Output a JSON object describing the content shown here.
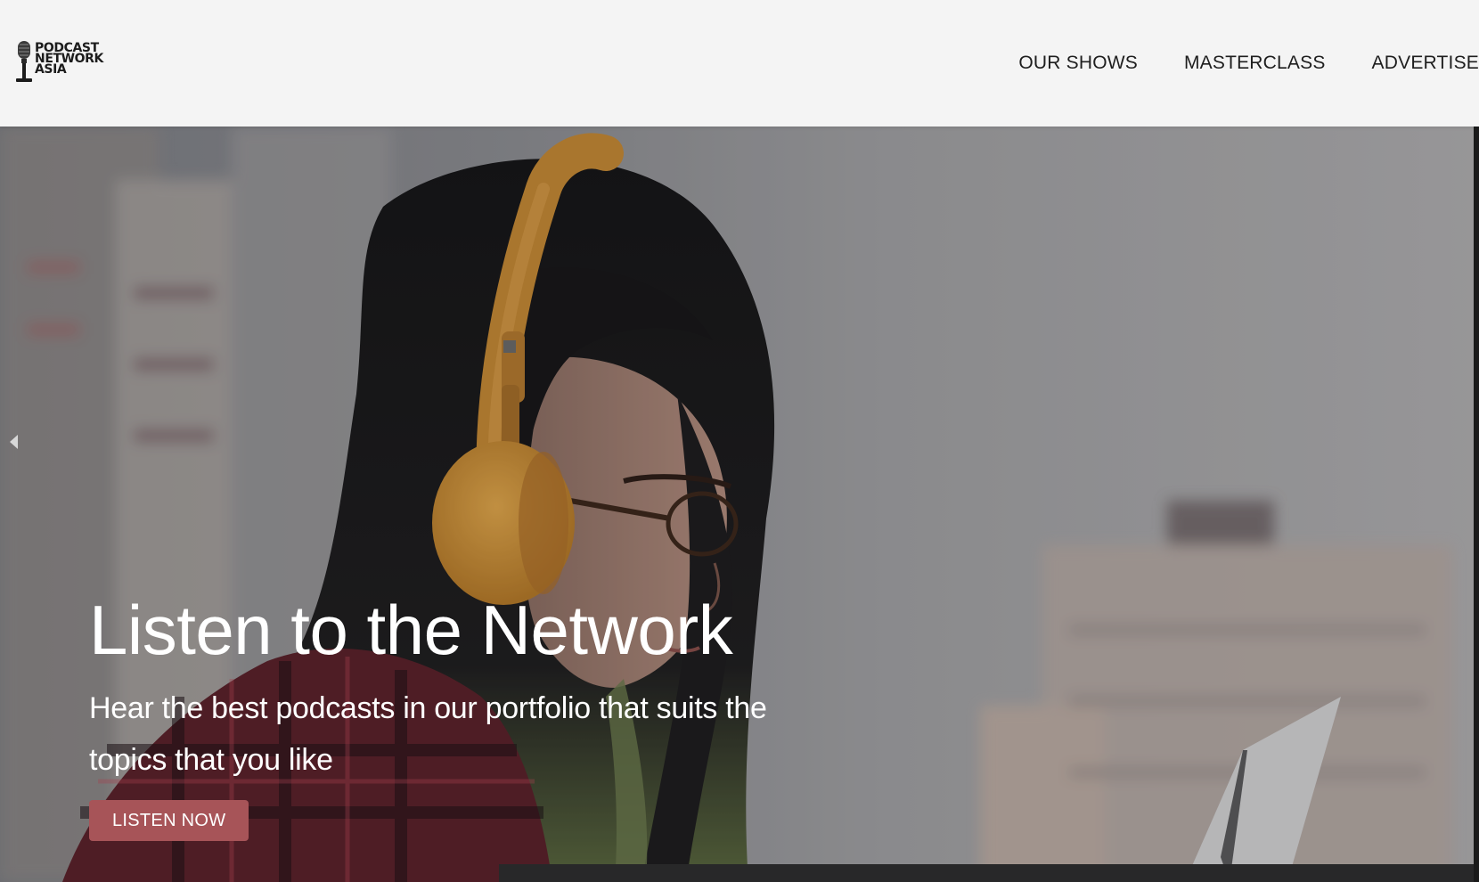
{
  "brand": {
    "logo_lines": [
      "PODCAST",
      "NETWORK",
      "ASIA"
    ],
    "logo_icon": "microphone-icon"
  },
  "nav": {
    "items": [
      {
        "label": "OUR SHOWS"
      },
      {
        "label": "MASTERCLASS"
      },
      {
        "label": "ADVERTISE"
      }
    ]
  },
  "hero": {
    "title": "Listen to the Network",
    "subtitle": "Hear the best podcasts in our portfolio that suits the topics that you like",
    "cta_label": "LISTEN NOW",
    "prev_icon": "chevron-left-icon",
    "image_subject": "woman-with-headphones-at-laptop"
  },
  "colors": {
    "accent": "#a75458",
    "header_bg": "#f4f4f4",
    "nav_text": "#1e1e1e",
    "hero_text": "#ffffff",
    "headphones": "#d99a3c"
  }
}
